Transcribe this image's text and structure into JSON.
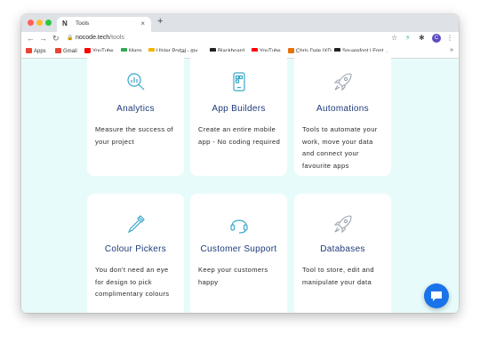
{
  "browser": {
    "tab_title": "Tools",
    "tab_favicon": "N",
    "url_domain": "nocode.tech",
    "url_path": "/tools",
    "profile_initial": "C",
    "bookmarks": [
      {
        "label": "Apps",
        "color": "#ea4335"
      },
      {
        "label": "Gmail",
        "color": "#ea4335"
      },
      {
        "label": "YouTube",
        "color": "#ff0000"
      },
      {
        "label": "Maps",
        "color": "#34a853"
      },
      {
        "label": "Ulster Portal - my...",
        "color": "#f4b400"
      },
      {
        "label": "Blackboard",
        "color": "#222222"
      },
      {
        "label": "YouTube",
        "color": "#ff0000"
      },
      {
        "label": "Chris Dale IXD",
        "color": "#e8710a"
      },
      {
        "label": "Squarefont | Font...",
        "color": "#222222"
      }
    ]
  },
  "cards": [
    {
      "title": "Analytics",
      "description": "Measure the success of your project",
      "icon": "analytics-magnifier-icon"
    },
    {
      "title": "App Builders",
      "description": "Create an entire mobile app - No coding required",
      "icon": "mobile-app-icon"
    },
    {
      "title": "Automations",
      "description": "Tools to automate your work, move your data and connect your favourite apps",
      "icon": "rocket-icon"
    },
    {
      "title": "Colour Pickers",
      "description": "You don't need an eye for design to pick complimentary colours",
      "icon": "eyedropper-icon"
    },
    {
      "title": "Customer Support",
      "description": "Keep your customers happy",
      "icon": "headset-icon"
    },
    {
      "title": "Databases",
      "description": "Tool to store, edit and manipulate your data",
      "icon": "rocket-icon"
    }
  ],
  "colors": {
    "accent": "#1a73e8",
    "title": "#1d3a7a",
    "icon": "#3aa8c8",
    "background": "#e8fbfb"
  }
}
